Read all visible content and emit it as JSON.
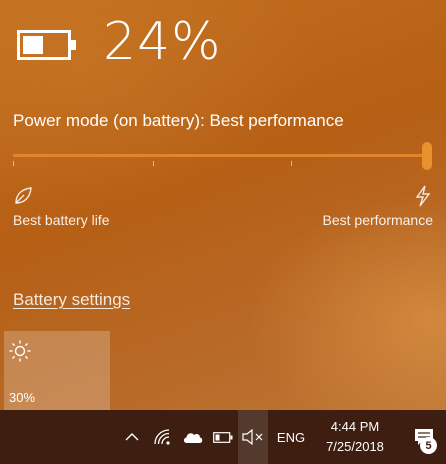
{
  "battery": {
    "percent_label": "24%",
    "level": 0.24
  },
  "power_mode": {
    "title": "Power mode (on battery): Best performance",
    "slider_value": 1.0,
    "left_label": "Best battery life",
    "right_label": "Best performance",
    "left_icon": "leaf-icon",
    "right_icon": "bolt-icon"
  },
  "battery_settings_link": "Battery settings",
  "brightness_tile": {
    "icon": "sun-icon",
    "label": "30%"
  },
  "taskbar": {
    "language": "ENG",
    "time": "4:44 PM",
    "date": "7/25/2018",
    "notification_count": "5",
    "icons": [
      "chevron-up-icon",
      "wifi-icon",
      "onedrive-cloud-icon",
      "battery-icon",
      "volume-muted-icon",
      "action-center-icon"
    ]
  },
  "colors": {
    "accent": "#e2872c",
    "taskbar": "#3d1e10"
  }
}
